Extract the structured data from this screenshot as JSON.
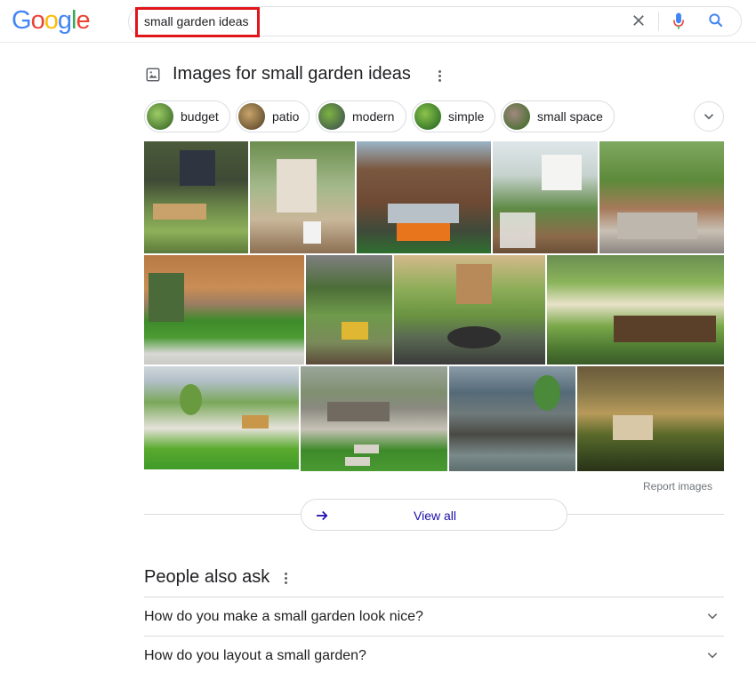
{
  "header": {
    "logo_letters": [
      "G",
      "o",
      "o",
      "g",
      "l",
      "e"
    ],
    "logo_colors": [
      "#4285f4",
      "#ea4335",
      "#fbbc05",
      "#4285f4",
      "#34a853",
      "#ea4335"
    ],
    "query": "small garden ideas",
    "highlight_color": "#e0161b"
  },
  "images": {
    "title": "Images for small garden ideas",
    "chips": [
      {
        "label": "budget"
      },
      {
        "label": "patio"
      },
      {
        "label": "modern"
      },
      {
        "label": "simple"
      },
      {
        "label": "small space"
      }
    ],
    "tile_count": 14,
    "report_label": "Report images",
    "view_all_label": "View all"
  },
  "people_also_ask": {
    "title": "People also ask",
    "questions": [
      "How do you make a small garden look nice?",
      "How do you layout a small garden?"
    ]
  },
  "colors": {
    "link": "#1a0dab",
    "icon_gray": "#5f6368",
    "mic_red": "#ea4335",
    "mic_blue": "#4285f4",
    "search_blue": "#4285f4"
  }
}
